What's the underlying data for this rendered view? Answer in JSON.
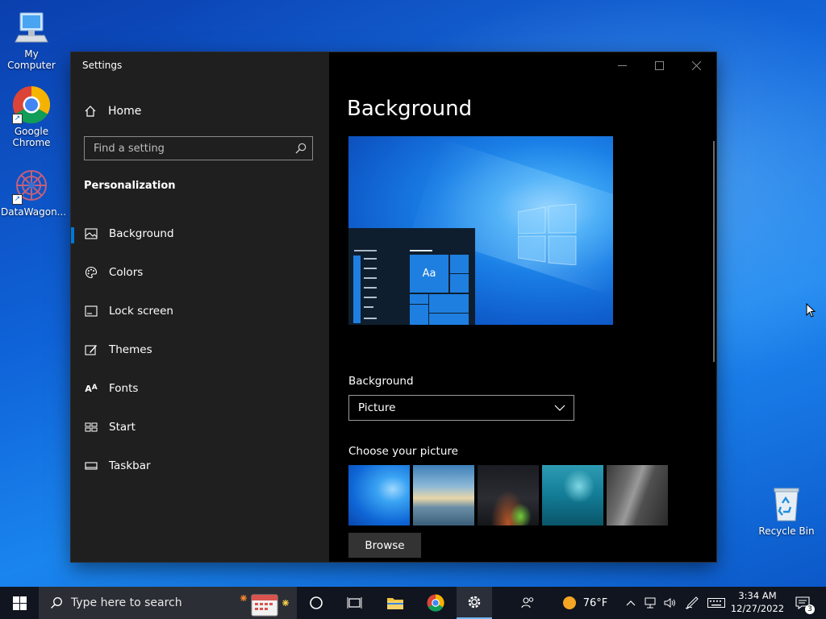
{
  "desktop": {
    "icons": [
      {
        "label": "My Computer"
      },
      {
        "label": "Google Chrome"
      },
      {
        "label": "DataWagon..."
      },
      {
        "label": "Recycle Bin"
      }
    ]
  },
  "window": {
    "title": "Settings",
    "controls": [
      "minimize-icon",
      "maximize-icon",
      "close-icon"
    ]
  },
  "sidebar": {
    "home_label": "Home",
    "search_placeholder": "Find a setting",
    "section_title": "Personalization",
    "items": [
      {
        "label": "Background",
        "icon": "picture-icon",
        "selected": true
      },
      {
        "label": "Colors",
        "icon": "palette-icon",
        "selected": false
      },
      {
        "label": "Lock screen",
        "icon": "lock-screen-icon",
        "selected": false
      },
      {
        "label": "Themes",
        "icon": "themes-icon",
        "selected": false
      },
      {
        "label": "Fonts",
        "icon": "fonts-icon",
        "selected": false
      },
      {
        "label": "Start",
        "icon": "start-icon",
        "selected": false
      },
      {
        "label": "Taskbar",
        "icon": "taskbar-icon",
        "selected": false
      }
    ]
  },
  "main": {
    "title": "Background",
    "preview_tile_text": "Aa",
    "background_label": "Background",
    "background_value": "Picture",
    "choose_label": "Choose your picture",
    "browse_label": "Browse"
  },
  "taskbar": {
    "search_placeholder": "Type here to search",
    "weather_temp": "76°F",
    "time": "3:34 AM",
    "date": "12/27/2022",
    "notification_count": "3"
  },
  "colors": {
    "accent": "#0078d7",
    "sidebar_bg": "#1f1f1f",
    "content_bg": "#000000",
    "taskbar_bg": "#101520"
  }
}
